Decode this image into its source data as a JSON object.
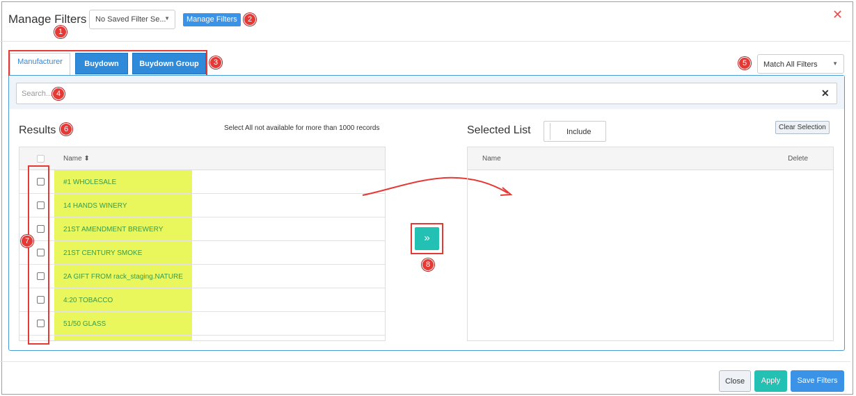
{
  "header": {
    "title": "Manage Filters",
    "saved_filter_value": "No Saved Filter Se...",
    "manage_button": "Manage Filters",
    "close_glyph": "✕"
  },
  "tabs": [
    "Manufacturer",
    "Buydown",
    "Buydown Group"
  ],
  "match_select": {
    "value": "Match All Filters"
  },
  "search": {
    "placeholder": "Search...",
    "clear_glyph": "✕"
  },
  "results": {
    "heading": "Results",
    "note": "Select All not available for more than 1000 records",
    "column_name": "Name",
    "sort_icon": "⬍",
    "rows": [
      "#1 WHOLESALE",
      "14 HANDS WINERY",
      "21ST AMENDMENT BREWERY",
      "21ST CENTURY SMOKE",
      "2A GIFT FROM rack_staging.NATURE",
      "4:20 TOBACCO",
      "51/50 GLASS"
    ]
  },
  "move_button_glyph": "»",
  "selected": {
    "heading": "Selected List",
    "include_label": "Include",
    "clear_button": "Clear Selection",
    "col_name": "Name",
    "col_delete": "Delete"
  },
  "footer": {
    "close": "Close",
    "apply": "Apply",
    "save": "Save Filters"
  },
  "markers": [
    "1",
    "2",
    "3",
    "4",
    "5",
    "6",
    "7",
    "8"
  ],
  "colors": {
    "primary": "#3a93e6",
    "teal": "#22c1b4",
    "annotation_red": "#e53935",
    "highlight": "#e9f75c"
  }
}
